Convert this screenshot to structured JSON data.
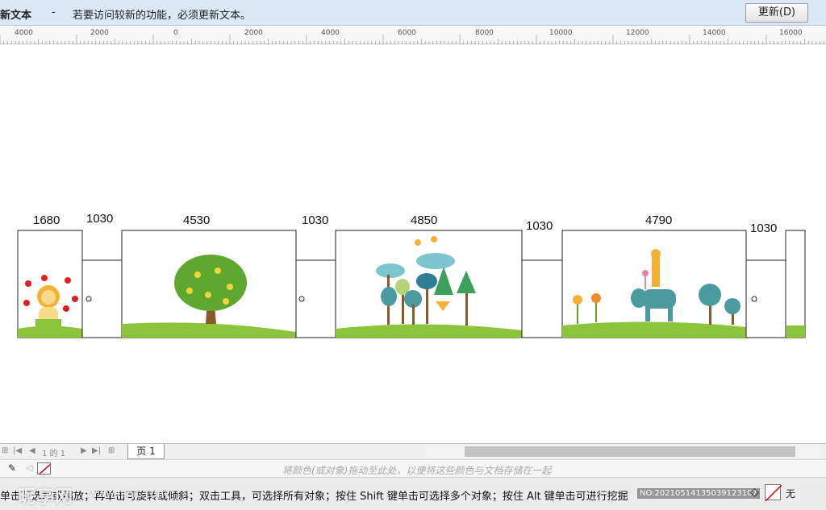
{
  "notice": {
    "title": "新文本",
    "dash": "-",
    "message": "若要访问较新的功能，必须更新文本。",
    "update_button": "更新(D)"
  },
  "ruler": {
    "labels": [
      "4000",
      "2000",
      "0",
      "2000",
      "4000",
      "6000",
      "8000",
      "10000",
      "12000",
      "14000",
      "16000"
    ]
  },
  "drawing": {
    "dimensions": [
      "1680",
      "1030",
      "4530",
      "1030",
      "4850",
      "1030",
      "4790",
      "1030"
    ],
    "colors": {
      "grass": "#8cc43c",
      "outline": "#222222",
      "tree_green": "#5fa830",
      "elephant": "#4a9aa0",
      "trunk": "#8b5a2b"
    }
  },
  "pagebar": {
    "page_counter": "1 的 1",
    "page_tab": "页 1"
  },
  "colorbar": {
    "hint": "将颜色(或对象)拖动至此处，以便将这些颜色与文档存储在一起"
  },
  "status": {
    "text": "单击可选取或缩放；再单击可旋转或倾斜；双击工具，可选择所有对象；按住 Shift 键单击可选择多个对象；按住 Alt 键单击可进行挖掘",
    "watermark": "昵享网",
    "watermark2": "www.nipic.com",
    "id": "NO:20210514135039123107"
  }
}
